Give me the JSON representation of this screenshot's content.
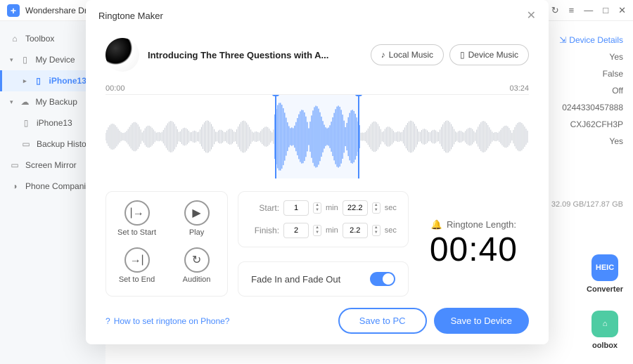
{
  "app": {
    "name": "Wondershare Dr.Fone"
  },
  "sidebar": {
    "toolbox": "Toolbox",
    "my_device": "My Device",
    "iphone13": "iPhone13",
    "my_backup": "My Backup",
    "backup_iphone13": "iPhone13",
    "backup_history": "Backup History",
    "screen_mirror": "Screen Mirror",
    "phone_companion": "Phone Companion"
  },
  "details": {
    "link": "Device Details",
    "v0": "Yes",
    "v1": "False",
    "v2": "Off",
    "v3": "0244330457888",
    "v4": "CXJ62CFH3P",
    "v5": "Yes"
  },
  "storage": "32.09 GB/127.87 GB",
  "tools": {
    "converter": "Converter",
    "toolbox": "oolbox",
    "heic": "HEIC"
  },
  "modal": {
    "title": "Ringtone Maker",
    "track": "Introducing The Three Questions with A...",
    "local_music": "Local Music",
    "device_music": "Device Music",
    "wave_start": "00:00",
    "wave_end": "03:24",
    "set_to_start": "Set to Start",
    "play": "Play",
    "set_to_end": "Set to End",
    "audition": "Audition",
    "start_label": "Start:",
    "finish_label": "Finish:",
    "min": "min",
    "sec": "sec",
    "start_min": "1",
    "start_sec": "22.2",
    "finish_min": "2",
    "finish_sec": "2.2",
    "length_label": "Ringtone Length:",
    "length_value": "00:40",
    "fade": "Fade In and Fade Out",
    "help": "How to set ringtone on Phone?",
    "save_pc": "Save to PC",
    "save_device": "Save to Device"
  }
}
